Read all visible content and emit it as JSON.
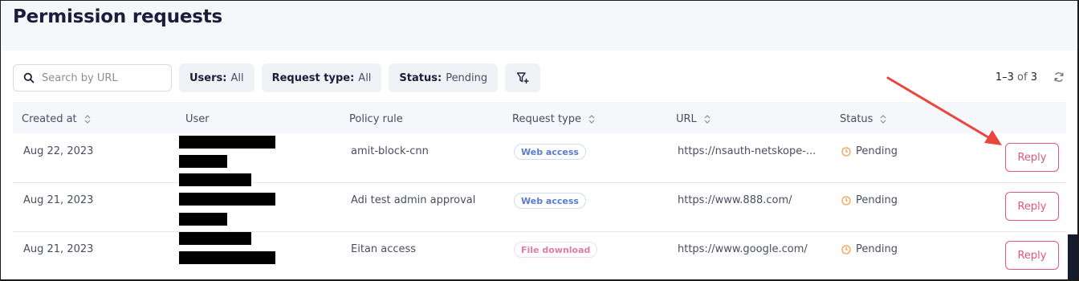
{
  "page": {
    "title": "Permission requests"
  },
  "toolbar": {
    "search": {
      "placeholder": "Search by URL",
      "value": "",
      "icon": "search-icon"
    },
    "filters": [
      {
        "key": "Users:",
        "value": "All"
      },
      {
        "key": "Request type:",
        "value": "All"
      },
      {
        "key": "Status:",
        "value": "Pending"
      }
    ],
    "add_filter_icon": "filter-plus-icon"
  },
  "pagination": {
    "range": "1–3",
    "of": "of",
    "total": "3",
    "refresh_icon": "refresh-icon"
  },
  "table": {
    "columns": [
      "Created at",
      "User",
      "Policy rule",
      "Request type",
      "URL",
      "Status"
    ],
    "sortable": [
      "Created at",
      "Request type",
      "URL",
      "Status"
    ],
    "rows": [
      {
        "created_at": "Aug 22, 2023",
        "user": "",
        "policy_rule": "amit-block-cnn",
        "request_type": "Web access",
        "url": "https://nsauth-netskope-...",
        "status": "Pending",
        "action": "Reply"
      },
      {
        "created_at": "Aug 21, 2023",
        "user": "",
        "policy_rule": "Adi test admin approval",
        "request_type": "Web access",
        "url": "https://www.888.com/",
        "status": "Pending",
        "action": "Reply"
      },
      {
        "created_at": "Aug 21, 2023",
        "user": "",
        "policy_rule": "Eitan access",
        "request_type": "File download",
        "url": "https://www.google.com/",
        "status": "Pending",
        "action": "Reply"
      }
    ]
  },
  "colors": {
    "accent": "#e1567f",
    "web_tag": "#5a7ad1",
    "file_tag": "#e27ba6",
    "pending": "#f0a04b",
    "annotation_arrow": "#e8453c"
  }
}
